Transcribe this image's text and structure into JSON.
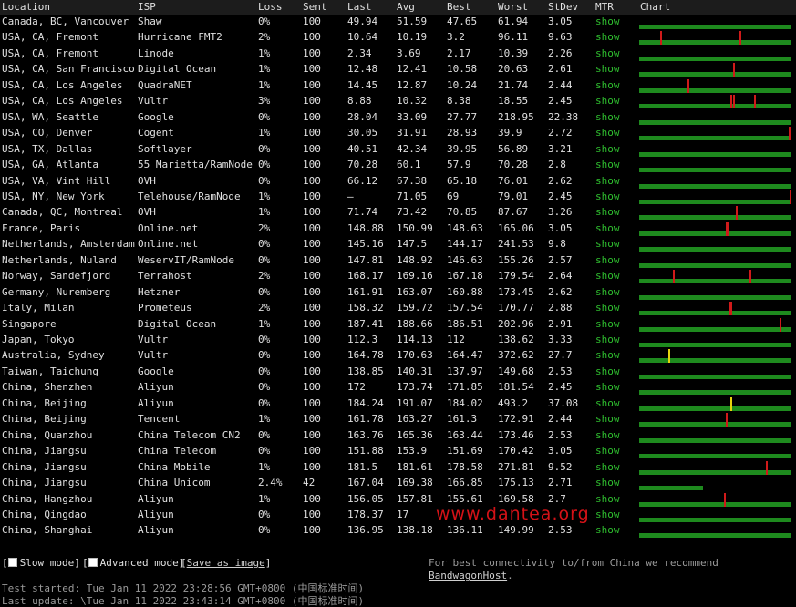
{
  "headers": [
    "Location",
    "ISP",
    "Loss",
    "Sent",
    "Last",
    "Avg",
    "Best",
    "Worst",
    "StDev",
    "MTR",
    "Chart"
  ],
  "rows": [
    {
      "location": "Canada, BC, Vancouver",
      "isp": "Shaw",
      "loss": "0%",
      "sent": "100",
      "last": "49.94",
      "avg": "51.59",
      "best": "47.65",
      "worst": "61.94",
      "stdev": "3.05",
      "mtr": "show",
      "spikes": []
    },
    {
      "location": "USA, CA, Fremont",
      "isp": "Hurricane FMT2",
      "loss": "2%",
      "sent": "100",
      "last": "10.64",
      "avg": "10.19",
      "best": "3.2",
      "worst": "96.11",
      "stdev": "9.63",
      "mtr": "show",
      "spikes": [
        {
          "at": 0.14,
          "color": "#d01a1a"
        },
        {
          "at": 0.66,
          "color": "#d01a1a"
        }
      ]
    },
    {
      "location": "USA, CA, Fremont",
      "isp": "Linode",
      "loss": "1%",
      "sent": "100",
      "last": "2.34",
      "avg": "3.69",
      "best": "2.17",
      "worst": "10.39",
      "stdev": "2.26",
      "mtr": "show",
      "spikes": []
    },
    {
      "location": "USA, CA, San Francisco",
      "isp": "Digital Ocean",
      "loss": "1%",
      "sent": "100",
      "last": "12.48",
      "avg": "12.41",
      "best": "10.58",
      "worst": "20.63",
      "stdev": "2.61",
      "mtr": "show",
      "spikes": [
        {
          "at": 0.62,
          "color": "#d01a1a"
        }
      ]
    },
    {
      "location": "USA, CA, Los Angeles",
      "isp": "QuadraNET",
      "loss": "1%",
      "sent": "100",
      "last": "14.45",
      "avg": "12.87",
      "best": "10.24",
      "worst": "21.74",
      "stdev": "2.44",
      "mtr": "show",
      "spikes": [
        {
          "at": 0.32,
          "color": "#d01a1a"
        }
      ]
    },
    {
      "location": "USA, CA, Los Angeles",
      "isp": "Vultr",
      "loss": "3%",
      "sent": "100",
      "last": "8.88",
      "avg": "10.32",
      "best": "8.38",
      "worst": "18.55",
      "stdev": "2.45",
      "mtr": "show",
      "spikes": [
        {
          "at": 0.6,
          "color": "#d01a1a"
        },
        {
          "at": 0.62,
          "color": "#d01a1a"
        },
        {
          "at": 0.76,
          "color": "#d01a1a"
        }
      ]
    },
    {
      "location": "USA, WA, Seattle",
      "isp": "Google",
      "loss": "0%",
      "sent": "100",
      "last": "28.04",
      "avg": "33.09",
      "best": "27.77",
      "worst": "218.95",
      "stdev": "22.38",
      "mtr": "show",
      "spikes": []
    },
    {
      "location": "USA, CO, Denver",
      "isp": "Cogent",
      "loss": "1%",
      "sent": "100",
      "last": "30.05",
      "avg": "31.91",
      "best": "28.93",
      "worst": "39.9",
      "stdev": "2.72",
      "mtr": "show",
      "spikes": [
        {
          "at": 0.985,
          "color": "#d01a1a"
        }
      ]
    },
    {
      "location": "USA, TX, Dallas",
      "isp": "Softlayer",
      "loss": "0%",
      "sent": "100",
      "last": "40.51",
      "avg": "42.34",
      "best": "39.95",
      "worst": "56.89",
      "stdev": "3.21",
      "mtr": "show",
      "spikes": []
    },
    {
      "location": "USA, GA, Atlanta",
      "isp": "55 Marietta/RamNode",
      "loss": "0%",
      "sent": "100",
      "last": "70.28",
      "avg": "60.1",
      "best": "57.9",
      "worst": "70.28",
      "stdev": "2.8",
      "mtr": "show",
      "spikes": []
    },
    {
      "location": "USA, VA, Vint Hill",
      "isp": "OVH",
      "loss": "0%",
      "sent": "100",
      "last": "66.12",
      "avg": "67.38",
      "best": "65.18",
      "worst": "76.01",
      "stdev": "2.62",
      "mtr": "show",
      "spikes": []
    },
    {
      "location": "USA, NY, New York",
      "isp": "Telehouse/RamNode",
      "loss": "1%",
      "sent": "100",
      "last": "–",
      "avg": "71.05",
      "best": "69",
      "worst": "79.01",
      "stdev": "2.45",
      "mtr": "show",
      "spikes": [
        {
          "at": 0.995,
          "color": "#d01a1a"
        }
      ]
    },
    {
      "location": "Canada, QC, Montreal",
      "isp": "OVH",
      "loss": "1%",
      "sent": "100",
      "last": "71.74",
      "avg": "73.42",
      "best": "70.85",
      "worst": "87.67",
      "stdev": "3.26",
      "mtr": "show",
      "spikes": [
        {
          "at": 0.64,
          "color": "#d01a1a"
        }
      ]
    },
    {
      "location": "France, Paris",
      "isp": "Online.net",
      "loss": "2%",
      "sent": "100",
      "last": "148.88",
      "avg": "150.99",
      "best": "148.63",
      "worst": "165.06",
      "stdev": "3.05",
      "mtr": "show",
      "spikes": [
        {
          "at": 0.57,
          "color": "#d01a1a"
        },
        {
          "at": 0.58,
          "color": "#d01a1a"
        }
      ]
    },
    {
      "location": "Netherlands, Amsterdam",
      "isp": "Online.net",
      "loss": "0%",
      "sent": "100",
      "last": "145.16",
      "avg": "147.5",
      "best": "144.17",
      "worst": "241.53",
      "stdev": "9.8",
      "mtr": "show",
      "spikes": []
    },
    {
      "location": "Netherlands, Nuland",
      "isp": "WeservIT/RamNode",
      "loss": "0%",
      "sent": "100",
      "last": "147.81",
      "avg": "148.92",
      "best": "146.63",
      "worst": "155.26",
      "stdev": "2.57",
      "mtr": "show",
      "spikes": []
    },
    {
      "location": "Norway, Sandefjord",
      "isp": "Terrahost",
      "loss": "2%",
      "sent": "100",
      "last": "168.17",
      "avg": "169.16",
      "best": "167.18",
      "worst": "179.54",
      "stdev": "2.64",
      "mtr": "show",
      "spikes": [
        {
          "at": 0.22,
          "color": "#d01a1a"
        },
        {
          "at": 0.73,
          "color": "#d01a1a"
        }
      ]
    },
    {
      "location": "Germany, Nuremberg",
      "isp": "Hetzner",
      "loss": "0%",
      "sent": "100",
      "last": "161.91",
      "avg": "163.07",
      "best": "160.88",
      "worst": "173.45",
      "stdev": "2.62",
      "mtr": "show",
      "spikes": []
    },
    {
      "location": "Italy, Milan",
      "isp": "Prometeus",
      "loss": "2%",
      "sent": "100",
      "last": "158.32",
      "avg": "159.72",
      "best": "157.54",
      "worst": "170.77",
      "stdev": "2.88",
      "mtr": "show",
      "spikes": [
        {
          "at": 0.59,
          "color": "#d01a1a"
        },
        {
          "at": 0.6,
          "color": "#d01a1a"
        }
      ]
    },
    {
      "location": "Singapore",
      "isp": "Digital Ocean",
      "loss": "1%",
      "sent": "100",
      "last": "187.41",
      "avg": "188.66",
      "best": "186.51",
      "worst": "202.96",
      "stdev": "2.91",
      "mtr": "show",
      "spikes": [
        {
          "at": 0.93,
          "color": "#d01a1a"
        }
      ]
    },
    {
      "location": "Japan, Tokyo",
      "isp": "Vultr",
      "loss": "0%",
      "sent": "100",
      "last": "112.3",
      "avg": "114.13",
      "best": "112",
      "worst": "138.62",
      "stdev": "3.33",
      "mtr": "show",
      "spikes": []
    },
    {
      "location": "Australia, Sydney",
      "isp": "Vultr",
      "loss": "0%",
      "sent": "100",
      "last": "164.78",
      "avg": "170.63",
      "best": "164.47",
      "worst": "372.62",
      "stdev": "27.7",
      "mtr": "show",
      "spikes": [
        {
          "at": 0.19,
          "color": "#e6d40e"
        }
      ]
    },
    {
      "location": "Taiwan, Taichung",
      "isp": "Google",
      "loss": "0%",
      "sent": "100",
      "last": "138.85",
      "avg": "140.31",
      "best": "137.97",
      "worst": "149.68",
      "stdev": "2.53",
      "mtr": "show",
      "spikes": []
    },
    {
      "location": "China, Shenzhen",
      "isp": "Aliyun",
      "loss": "0%",
      "sent": "100",
      "last": "172",
      "avg": "173.74",
      "best": "171.85",
      "worst": "181.54",
      "stdev": "2.45",
      "mtr": "show",
      "spikes": []
    },
    {
      "location": "China, Beijing",
      "isp": "Aliyun",
      "loss": "0%",
      "sent": "100",
      "last": "184.24",
      "avg": "191.07",
      "best": "184.02",
      "worst": "493.2",
      "stdev": "37.08",
      "mtr": "show",
      "spikes": [
        {
          "at": 0.6,
          "color": "#e6d40e"
        }
      ]
    },
    {
      "location": "China, Beijing",
      "isp": "Tencent",
      "loss": "1%",
      "sent": "100",
      "last": "161.78",
      "avg": "163.27",
      "best": "161.3",
      "worst": "172.91",
      "stdev": "2.44",
      "mtr": "show",
      "spikes": [
        {
          "at": 0.57,
          "color": "#d01a1a"
        }
      ]
    },
    {
      "location": "China, Quanzhou",
      "isp": "China Telecom CN2",
      "loss": "0%",
      "sent": "100",
      "last": "163.76",
      "avg": "165.36",
      "best": "163.44",
      "worst": "173.46",
      "stdev": "2.53",
      "mtr": "show",
      "spikes": []
    },
    {
      "location": "China, Jiangsu",
      "isp": "China Telecom",
      "loss": "0%",
      "sent": "100",
      "last": "151.88",
      "avg": "153.9",
      "best": "151.69",
      "worst": "170.42",
      "stdev": "3.05",
      "mtr": "show",
      "spikes": []
    },
    {
      "location": "China, Jiangsu",
      "isp": "China Mobile",
      "loss": "1%",
      "sent": "100",
      "last": "181.5",
      "avg": "181.61",
      "best": "178.58",
      "worst": "271.81",
      "stdev": "9.52",
      "mtr": "show",
      "spikes": [
        {
          "at": 0.84,
          "color": "#d01a1a"
        }
      ]
    },
    {
      "location": "China, Jiangsu",
      "isp": "China Unicom",
      "loss": "2.4%",
      "sent": "42",
      "last": "167.04",
      "avg": "169.38",
      "best": "166.85",
      "worst": "175.13",
      "stdev": "2.71",
      "mtr": "show",
      "spikes": [],
      "bar_fill": 0.42
    },
    {
      "location": "China, Hangzhou",
      "isp": "Aliyun",
      "loss": "1%",
      "sent": "100",
      "last": "156.05",
      "avg": "157.81",
      "best": "155.61",
      "worst": "169.58",
      "stdev": "2.7",
      "mtr": "show",
      "spikes": [
        {
          "at": 0.56,
          "color": "#d01a1a"
        }
      ]
    },
    {
      "location": "China, Qingdao",
      "isp": "Aliyun",
      "loss": "0%",
      "sent": "100",
      "last": "178.37",
      "avg": "17",
      "best": "",
      "worst": "",
      "stdev": "",
      "mtr": "show",
      "spikes": []
    },
    {
      "location": "China, Shanghai",
      "isp": "Aliyun",
      "loss": "0%",
      "sent": "100",
      "last": "136.95",
      "avg": "138.18",
      "best": "136.11",
      "worst": "149.99",
      "stdev": "2.53",
      "mtr": "show",
      "spikes": []
    }
  ],
  "controls": {
    "slow_mode": "Slow mode",
    "advanced_mode": "Advanced mode",
    "save_as_image": "Save as image",
    "recommend_prefix": "For best connectivity to/from China we recommend ",
    "recommend_link": "BandwagonHost",
    "recommend_suffix": "."
  },
  "status": {
    "test_started": "Test started: Tue Jan 11 2022 23:28:56 GMT+0800 (中国标准时间)",
    "last_update": "Last update: \\Tue Jan 11 2022 23:43:14 GMT+0800 (中国标准时间)"
  },
  "watermark": "www.dantea.org",
  "colors": {
    "bar": "#1e8a1e",
    "loss_spike": "#d01a1a",
    "warn_spike": "#e6d40e",
    "link": "#2fbf2f"
  }
}
